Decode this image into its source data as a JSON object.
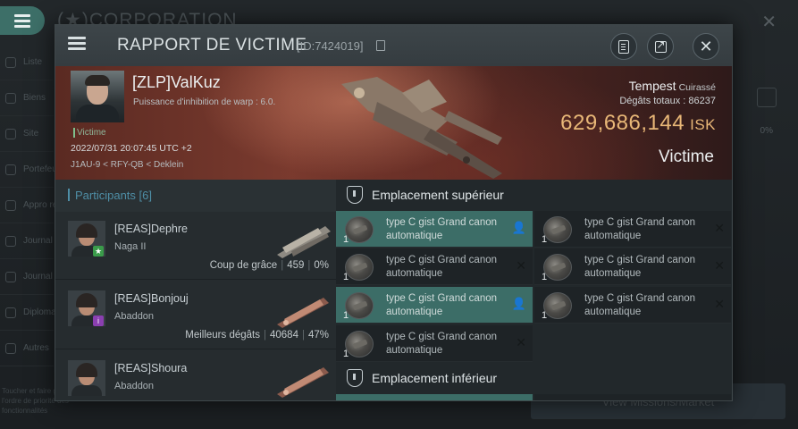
{
  "background": {
    "title": "CORPORATION",
    "sidebar": [
      "Liste",
      "Biens",
      "Site",
      "Portefeuille corpo",
      "Appro ressources",
      "Journal",
      "Journal corpo",
      "Diplomatie",
      "Autres"
    ],
    "footer_text": "Toucher et faire glisser l'ordre de priorité des fonctionnalités",
    "right_button": "View Missions/Market",
    "pct": "0%"
  },
  "modal": {
    "title": "RAPPORT DE VICTIME",
    "id": "[ID:7424019]"
  },
  "victim": {
    "name": "[ZLP]ValKuz",
    "subtitle": "Puissance d'inhibition de warp : 6.0.",
    "tag": "Victime",
    "datetime": "2022/07/31 20:07:45 UTC +2",
    "location": "J1AU-9 < RFY-QB < Deklein",
    "ship": "Tempest",
    "ship_class": "Cuirassé",
    "damage_label": "Dégâts totaux :",
    "damage_total": "86237",
    "isk_value": "629,686,144",
    "isk_currency": "ISK",
    "status": "Victime"
  },
  "participants": {
    "header": "Participants [6]",
    "rows": [
      {
        "name": "[REAS]Dephre",
        "ship": "Naga II",
        "stat_label": "Coup de grâce",
        "damage": "459",
        "pct": "0%",
        "badge": "★",
        "badge_color": "#3a9b4a"
      },
      {
        "name": "[REAS]Bonjouj",
        "ship": "Abaddon",
        "stat_label": "Meilleurs dégâts",
        "damage": "40684",
        "pct": "47%",
        "badge": "i",
        "badge_color": "#8a3fb0"
      },
      {
        "name": "[REAS]Shoura",
        "ship": "Abaddon",
        "stat_label": "",
        "damage": "",
        "pct": ""
      }
    ]
  },
  "slots": {
    "high_title": "Emplacement supérieur",
    "low_title": "Emplacement inférieur",
    "high": [
      {
        "name": "type C gist Grand canon automatique",
        "qty": "1",
        "highlight": true
      },
      {
        "name": "type C gist Grand canon automatique",
        "qty": "1",
        "highlight": false
      },
      {
        "name": "type C gist Grand canon automatique",
        "qty": "1",
        "highlight": false
      },
      {
        "name": "type C gist Grand canon automatique",
        "qty": "1",
        "highlight": false
      },
      {
        "name": "type C gist Grand canon automatique",
        "qty": "1",
        "highlight": true
      },
      {
        "name": "type C gist Grand canon automatique",
        "qty": "1",
        "highlight": false
      },
      {
        "name": "type C gist Grand canon automatique",
        "qty": "1",
        "highlight": false
      }
    ]
  },
  "colors": {
    "accent": "#3c6d67",
    "isk": "#e8b777",
    "participants_header": "#4e8ea6"
  }
}
